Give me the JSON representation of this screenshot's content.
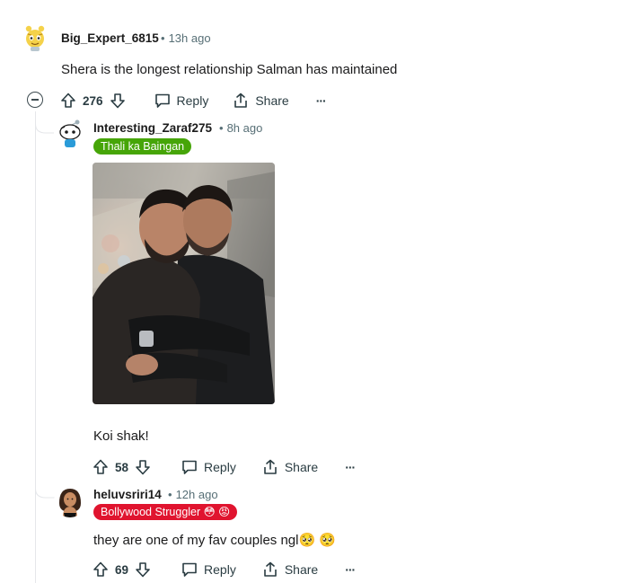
{
  "comments": [
    {
      "username": "Big_Expert_6815",
      "time": "13h ago",
      "body": "Shera is the longest relationship Salman has maintained",
      "score": "276",
      "reply_label": "Reply",
      "share_label": "Share",
      "more_label": "···"
    },
    {
      "username": "Interesting_Zaraf275",
      "time": "8h ago",
      "flair": "Thali ka Baingan",
      "flair_color": "#46a508",
      "body": "Koi shak!",
      "score": "58",
      "reply_label": "Reply",
      "share_label": "Share",
      "more_label": "···"
    },
    {
      "username": "heluvsriri14",
      "time": "12h ago",
      "flair": "Bollywood Struggler 😳 😡",
      "flair_color": "#e0142f",
      "body": "they are one of my fav couples ngl🥺 🥺",
      "score": "69",
      "reply_label": "Reply",
      "share_label": "Share",
      "more_label": "···"
    }
  ],
  "dot": "•",
  "icons": {
    "upvote": "arrow-up-icon",
    "downvote": "arrow-down-icon",
    "reply": "speech-bubble-icon",
    "share": "share-icon",
    "collapse": "minus-circle-icon"
  }
}
